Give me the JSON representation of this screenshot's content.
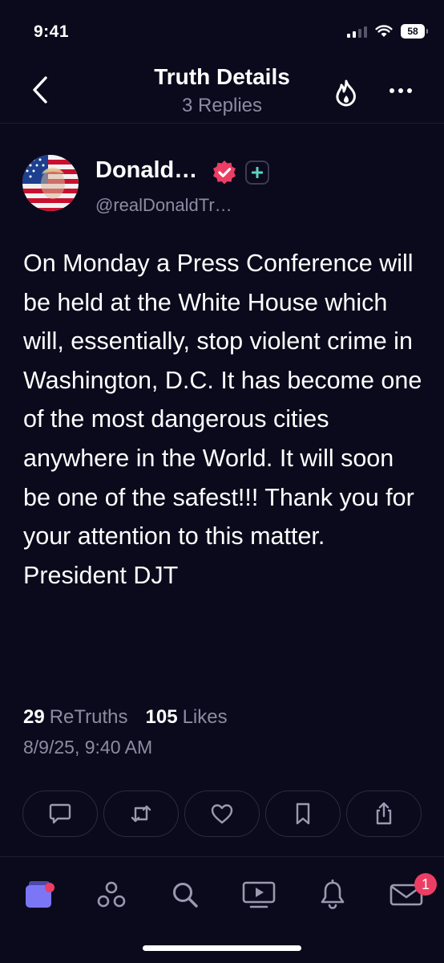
{
  "status_bar": {
    "time": "9:41",
    "battery": "58"
  },
  "header": {
    "title": "Truth Details",
    "subtitle": "3 Replies",
    "back_icon": "chevron-left-icon",
    "trending_icon": "flame-icon",
    "more_icon": "ellipsis-icon"
  },
  "post": {
    "author_name": "Donald…",
    "author_handle": "@realDonaldTr…",
    "body": "On Monday a Press Conference will be held at the White House which will, essentially, stop violent crime in Washington, D.C. It has become one of the most dangerous cities anywhere in the World. It will soon be one of the safest!!! Thank you for your attention to this matter. President DJT",
    "retruths_count": "29",
    "retruths_label": "ReTruths",
    "likes_count": "105",
    "likes_label": "Likes",
    "timestamp": "8/9/25, 9:40 AM"
  },
  "actions": [
    {
      "name": "reply",
      "icon": "comment-icon"
    },
    {
      "name": "retruth",
      "icon": "repost-icon"
    },
    {
      "name": "like",
      "icon": "heart-icon"
    },
    {
      "name": "bookmark",
      "icon": "bookmark-icon"
    },
    {
      "name": "share",
      "icon": "share-icon"
    }
  ],
  "bottom_nav": {
    "items": [
      {
        "name": "feed",
        "icon": "stacked-cards-icon"
      },
      {
        "name": "groups",
        "icon": "groups-icon"
      },
      {
        "name": "search",
        "icon": "search-icon"
      },
      {
        "name": "video",
        "icon": "video-icon"
      },
      {
        "name": "notifications",
        "icon": "bell-icon"
      },
      {
        "name": "messages",
        "icon": "envelope-icon"
      }
    ],
    "messages_badge": "1"
  },
  "colors": {
    "background": "#0b0a1c",
    "secondary_text": "#8d8ba2",
    "accent": "#ec3e64",
    "active_nav": "#7b76f5",
    "inactive_icon": "#9b99b0"
  }
}
